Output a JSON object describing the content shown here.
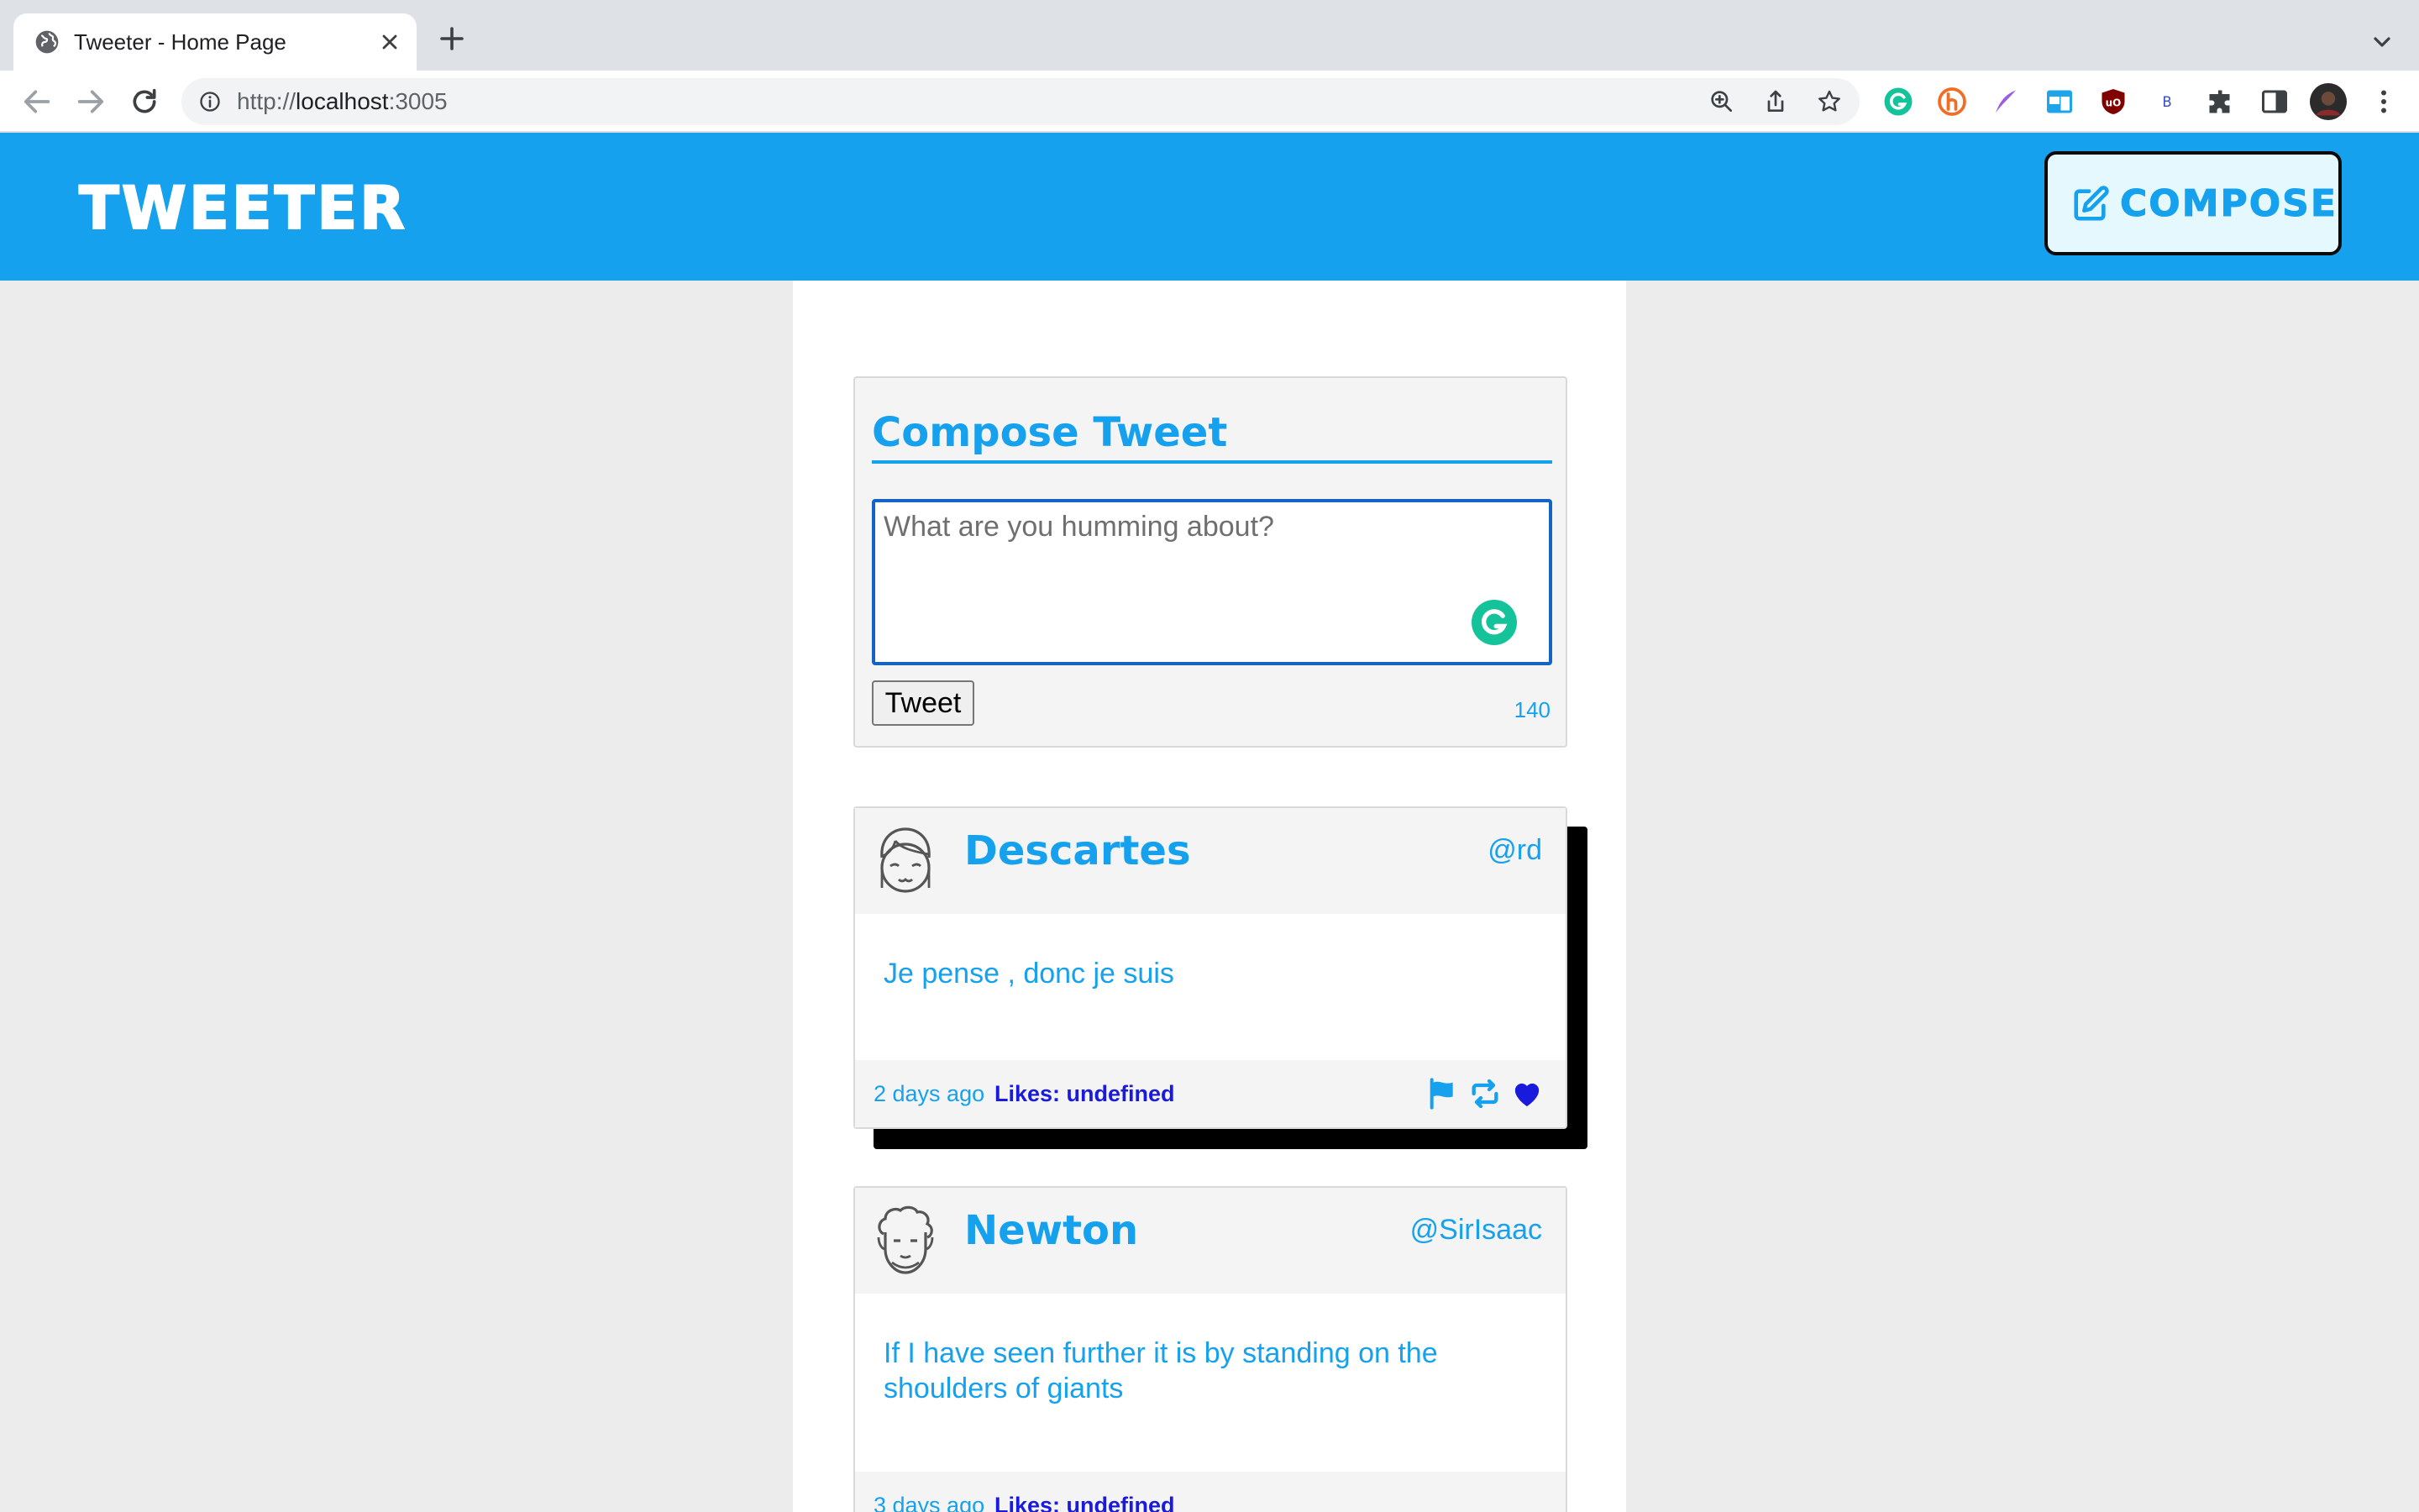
{
  "browser": {
    "tab_title": "Tweeter - Home Page",
    "url_scheme": "http://",
    "url_host": "localhost",
    "url_port": ":3005"
  },
  "header": {
    "logo": "TWEETER",
    "compose_label": "COMPOSE"
  },
  "composer": {
    "title": "Compose Tweet",
    "placeholder": "What are you humming about?",
    "submit_label": "Tweet",
    "char_count": "140"
  },
  "tweets": [
    {
      "name": "Descartes",
      "handle": "@rd",
      "text": "Je pense , donc je suis",
      "time": "2 days ago",
      "likes": "Likes: undefined"
    },
    {
      "name": "Newton",
      "handle": "@SirIsaac",
      "text": "If I have seen further it is by standing on the shoulders of giants",
      "time": "3 days ago",
      "likes": "Likes: undefined"
    }
  ],
  "colors": {
    "brand": "#16a1ee",
    "likes": "#1a1adc",
    "page_bg": "#ececec",
    "card_bg": "#f4f4f4"
  }
}
